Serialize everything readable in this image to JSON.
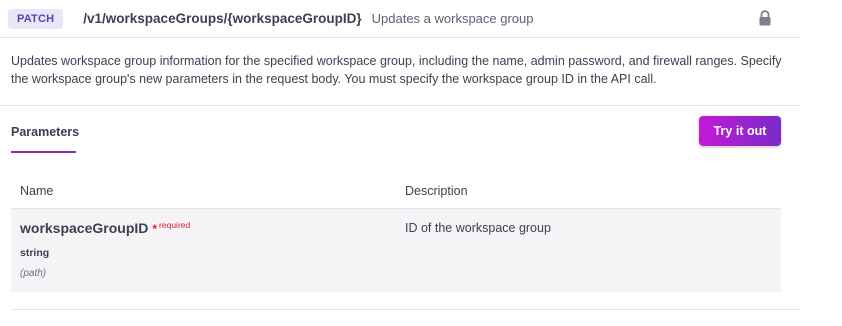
{
  "operation": {
    "method": "PATCH",
    "path": "/v1/workspaceGroups/{workspaceGroupID}",
    "summary": "Updates a workspace group",
    "lock_icon": "lock-icon",
    "description": "Updates workspace group information for the specified workspace group, including the name, admin password, and firewall ranges. Specify the workspace group's new parameters in the request body. You must specify the workspace group ID in the API call."
  },
  "parameters_section": {
    "tab_label": "Parameters",
    "try_button_label": "Try it out",
    "table": {
      "headers": {
        "name": "Name",
        "description": "Description"
      },
      "rows": [
        {
          "name": "workspaceGroupID",
          "required_marker": "*",
          "required_label": "required",
          "type": "string",
          "in": "(path)",
          "description": "ID of the workspace group"
        }
      ]
    }
  },
  "colors": {
    "method_badge_bg": "#e9e6f6",
    "method_badge_text": "#5a3fc0",
    "accent_gradient_start": "#c21ad6",
    "accent_gradient_end": "#7b2bc9",
    "required": "#e01e39"
  }
}
